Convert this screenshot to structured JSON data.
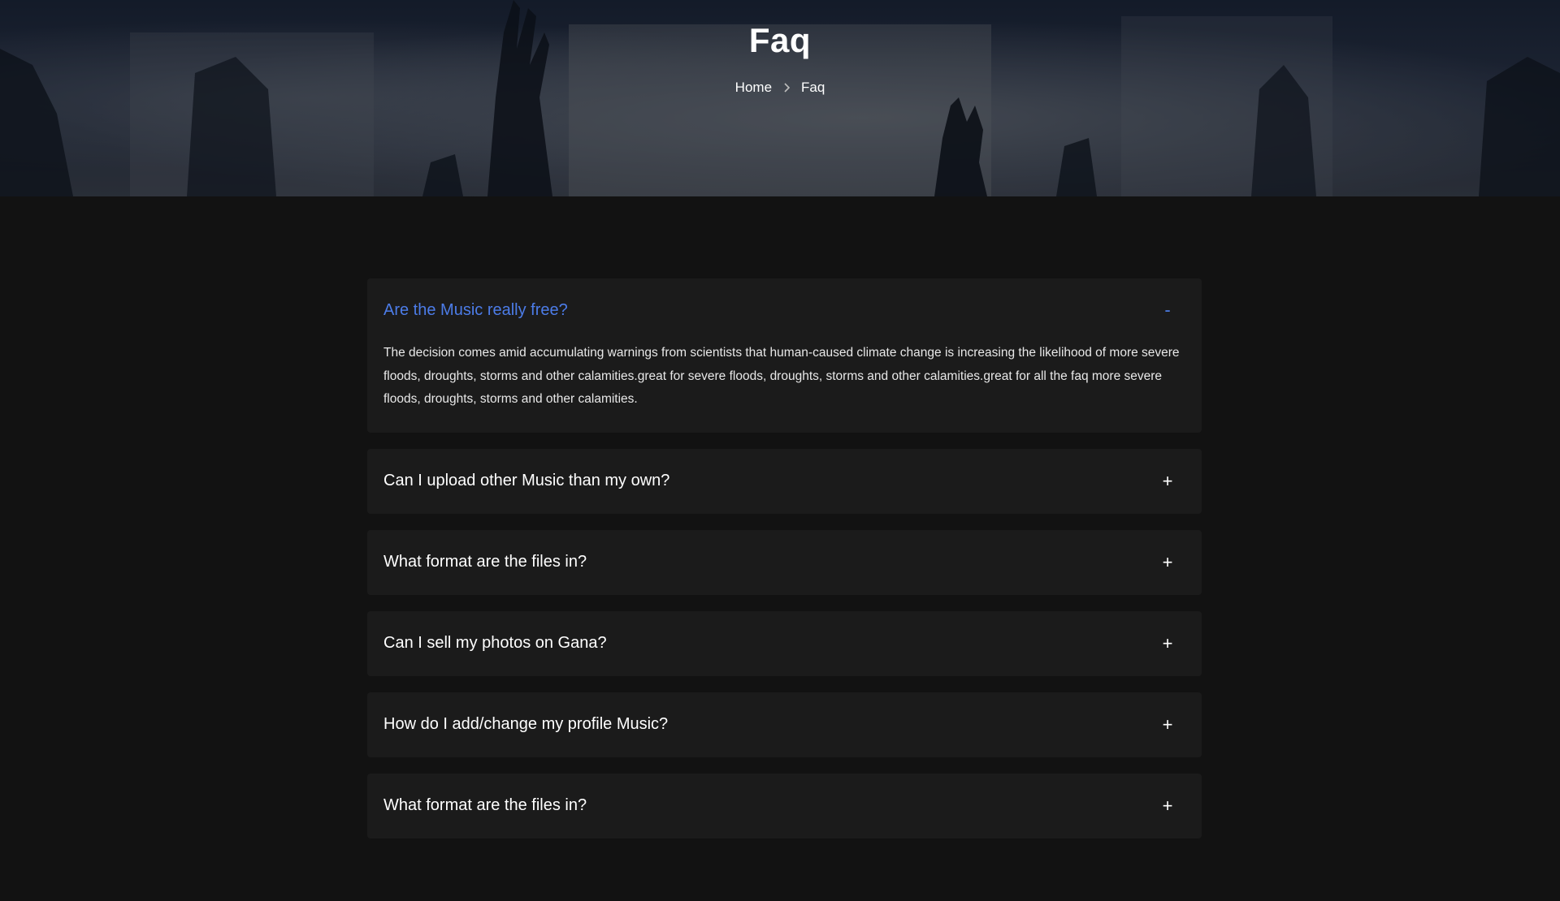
{
  "hero": {
    "title": "Faq",
    "breadcrumb": {
      "home": "Home",
      "current": "Faq"
    }
  },
  "faq": {
    "accent_color": "#4c7ce8",
    "items": [
      {
        "question": "Are the Music really free?",
        "toggle": "-",
        "open": true,
        "answer": "The decision comes amid accumulating warnings from scientists that human-caused climate change is increasing the likelihood of more severe floods, droughts, storms and other calamities.great for severe floods, droughts, storms and other calamities.great for all the faq more severe floods, droughts, storms and other calamities."
      },
      {
        "question": "Can I upload other Music than my own?",
        "toggle": "+",
        "open": false
      },
      {
        "question": "What format are the files in?",
        "toggle": "+",
        "open": false
      },
      {
        "question": "Can I sell my photos on Gana?",
        "toggle": "+",
        "open": false
      },
      {
        "question": "How do I add/change my profile Music?",
        "toggle": "+",
        "open": false
      },
      {
        "question": "What format are the files in?",
        "toggle": "+",
        "open": false
      }
    ]
  }
}
